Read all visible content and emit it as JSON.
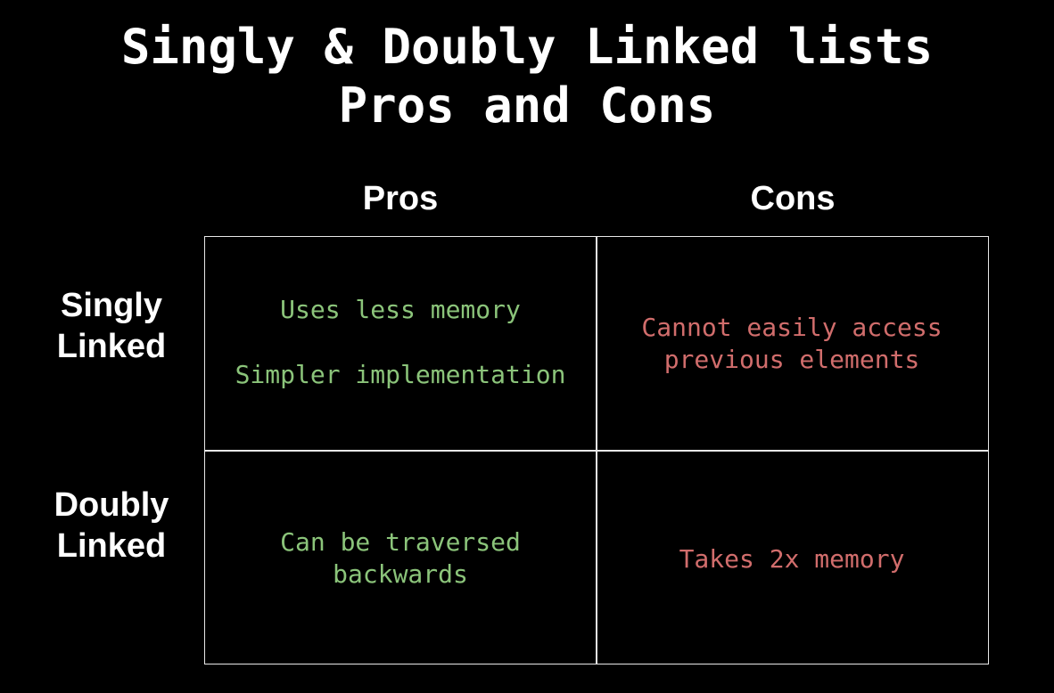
{
  "title": {
    "line1": "Singly & Doubly Linked lists",
    "line2": "Pros and Cons"
  },
  "columns": {
    "pros": "Pros",
    "cons": "Cons"
  },
  "rows": {
    "singly": {
      "line1": "Singly",
      "line2": "Linked"
    },
    "doubly": {
      "line1": "Doubly",
      "line2": "Linked"
    }
  },
  "cells": {
    "singly_pros": {
      "line1": "Uses less memory",
      "line2": "Simpler implementation"
    },
    "singly_cons": {
      "line1": "Cannot easily access",
      "line2": "previous elements"
    },
    "doubly_pros": {
      "line1": "Can be traversed",
      "line2": "backwards"
    },
    "doubly_cons": {
      "line1": "Takes 2x memory"
    }
  },
  "colors": {
    "background": "#000000",
    "text": "#ffffff",
    "pros": "#8bc47a",
    "cons": "#d16d6c",
    "grid": "#e8e8e8"
  }
}
